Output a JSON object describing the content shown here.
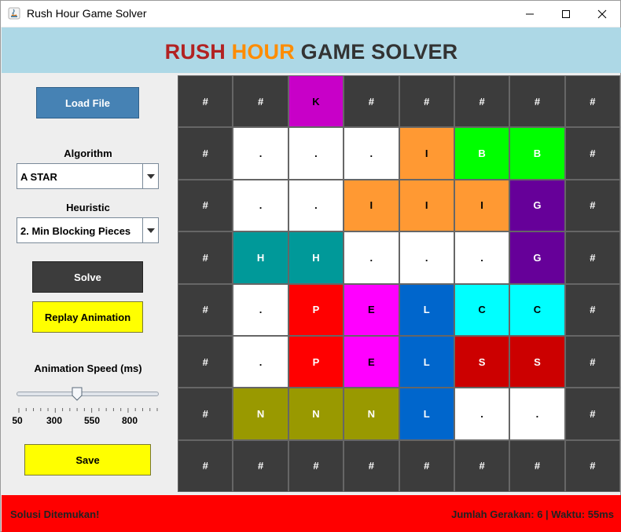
{
  "window": {
    "title": "Rush Hour Game Solver"
  },
  "header": {
    "part1": "RUSH",
    "part2": "HOUR",
    "part3": "GAME SOLVER"
  },
  "controls": {
    "load_label": "Load File",
    "algorithm_label": "Algorithm",
    "algorithm_value": "A STAR",
    "heuristic_label": "Heuristic",
    "heuristic_value": "2. Min Blocking Pieces",
    "solve_label": "Solve",
    "replay_label": "Replay Animation",
    "speed_label": "Animation Speed (ms)",
    "speed_value": 450,
    "speed_min": 50,
    "speed_max": 1000,
    "speed_ticks": [
      "50",
      "300",
      "550",
      "800"
    ],
    "save_label": "Save"
  },
  "board": {
    "rows": [
      [
        "#",
        "#",
        "K",
        "#",
        "#",
        "#",
        "#",
        "#"
      ],
      [
        "#",
        ".",
        ".",
        ".",
        "I",
        "B",
        "B",
        "#"
      ],
      [
        "#",
        ".",
        ".",
        "I",
        "I",
        "I",
        "G",
        "#"
      ],
      [
        "#",
        "H",
        "H",
        ".",
        ".",
        ".",
        "G",
        "#"
      ],
      [
        "#",
        ".",
        "P",
        "E",
        "L",
        "C",
        "C",
        "#"
      ],
      [
        "#",
        ".",
        "P",
        "E",
        "L",
        "S",
        "S",
        "#"
      ],
      [
        "#",
        "N",
        "N",
        "N",
        "L",
        ".",
        ".",
        "#"
      ],
      [
        "#",
        "#",
        "#",
        "#",
        "#",
        "#",
        "#",
        "#"
      ]
    ],
    "colors": {
      "#": "#3c3c3c",
      ".": "#ffffff",
      "K": "#c800c8",
      "I": "#ff9933",
      "B": "#00ff00",
      "G": "#660099",
      "H": "#009999",
      "P": "#ff0000",
      "E": "#ff00ff",
      "L": "#0066cc",
      "C": "#00ffff",
      "S": "#cc0000",
      "N": "#999900"
    },
    "text_colors": {
      "#": "#ffffff",
      ".": "#000000",
      "K": "#000000",
      "I": "#000000",
      "B": "#ffffff",
      "G": "#ffffff",
      "H": "#ffffff",
      "P": "#ffffff",
      "E": "#000000",
      "L": "#ffffff",
      "C": "#000000",
      "S": "#ffffff",
      "N": "#ffffff"
    }
  },
  "status": {
    "message": "Solusi Ditemukan!",
    "stats": "Jumlah Gerakan: 6 | Waktu: 55ms"
  }
}
